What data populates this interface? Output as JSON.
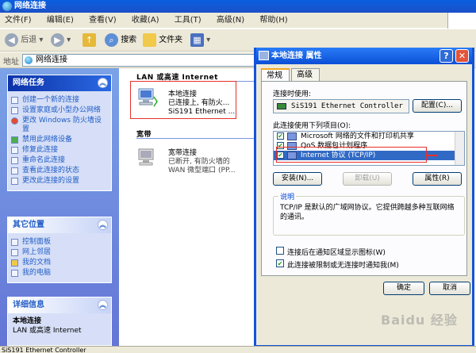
{
  "window": {
    "title": "网络连接"
  },
  "menu": [
    "文件(F)",
    "编辑(E)",
    "查看(V)",
    "收藏(A)",
    "工具(T)",
    "高级(N)",
    "帮助(H)"
  ],
  "toolbar": {
    "back": "后退",
    "search": "搜索",
    "folders": "文件夹"
  },
  "address": {
    "label": "地址",
    "value": "网络连接"
  },
  "sidebar": {
    "tasks": {
      "title": "网络任务",
      "items": [
        "创建一个新的连接",
        "设置家庭或小型办公网络",
        "更改 Windows 防火墙设置",
        "禁用此网络设备",
        "修复此连接",
        "重命名此连接",
        "查看此连接的状态",
        "更改此连接的设置"
      ]
    },
    "places": {
      "title": "其它位置",
      "items": [
        "控制面板",
        "网上邻居",
        "我的文档",
        "我的电脑"
      ]
    },
    "details": {
      "title": "详细信息",
      "name": "本地连接",
      "type": "LAN 或高速 Internet"
    }
  },
  "main": {
    "group_lan": "LAN 或高速 Internet",
    "lan_conn": {
      "name": "本地连接",
      "status": "已连接上, 有防火...",
      "device": "SiS191 Ethernet ..."
    },
    "group_broadband": "宽带",
    "broadband_conn": {
      "name": "宽带连接",
      "status": "已断开, 有防火墙的",
      "device": "WAN 微型端口 (PP..."
    }
  },
  "dialog": {
    "title": "本地连接 属性",
    "tabs": [
      "常规",
      "高级"
    ],
    "connect_using_label": "连接时使用:",
    "adapter": "SiS191 Ethernet Controller",
    "configure_button": "配置(C)...",
    "items_label": "此连接使用下列项目(O):",
    "items": [
      "Microsoft 网络的文件和打印机共享",
      "QoS 数据包计划程序",
      "Internet 协议 (TCP/IP)"
    ],
    "install_button": "安装(N)...",
    "uninstall_button": "卸载(U)",
    "properties_button": "属性(R)",
    "description_label": "说明",
    "description_text": "TCP/IP 是默认的广域网协议。它提供跨越多种互联网络的通讯。",
    "show_icon_checkbox": "连接后在通知区域显示图标(W)",
    "notify_checkbox": "此连接被限制或无连接时通知我(M)",
    "ok_button": "确定",
    "cancel_button": "取消"
  },
  "statusbar": {
    "text": "SiS191 Ethernet Controller"
  },
  "watermark": "Baidu 经验",
  "colors": {
    "title_blue": "#0a5fe0",
    "sidebar_blue": "#7ba2e7",
    "highlight_red": "#e8302a"
  }
}
